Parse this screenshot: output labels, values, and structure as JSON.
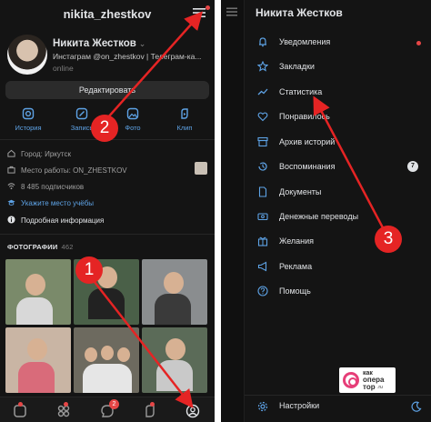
{
  "left": {
    "header_title": "nikita_zhestkov",
    "profile": {
      "name": "Никита Жестков",
      "status": "Инстаграм @on_zhestkov | Телеграм-ка...",
      "online": "online"
    },
    "edit_button": "Редактировать",
    "actions": [
      "История",
      "Запись",
      "Фото",
      "Клип"
    ],
    "info": {
      "city": "Город: Иркутск",
      "work": "Место работы: ON_ZHESTKOV",
      "followers": "8 485 подписчиков",
      "study": "Укажите место учёбы",
      "details": "Подробная информация"
    },
    "photos_title": "ФОТОГРАФИИ",
    "photos_count": "462",
    "tabbar_badge": "2"
  },
  "right": {
    "title": "Никита Жестков",
    "items": [
      {
        "label": "Уведомления",
        "icon": "bell-icon"
      },
      {
        "label": "Закладки",
        "icon": "star-icon"
      },
      {
        "label": "Статистика",
        "icon": "stats-icon"
      },
      {
        "label": "Понравилось",
        "icon": "heart-icon"
      },
      {
        "label": "Архив историй",
        "icon": "archive-icon"
      },
      {
        "label": "Воспоминания",
        "icon": "history-icon",
        "badge": "7"
      },
      {
        "label": "Документы",
        "icon": "document-icon"
      },
      {
        "label": "Денежные переводы",
        "icon": "money-icon"
      },
      {
        "label": "Желания",
        "icon": "wishlist-icon"
      },
      {
        "label": "Реклама",
        "icon": "megaphone-icon"
      },
      {
        "label": "Помощь",
        "icon": "help-icon"
      }
    ],
    "settings": "Настройки"
  },
  "watermark": {
    "line1": "как",
    "line2": "опера",
    "line3": "тор",
    "tld": ".ru"
  },
  "annotations": [
    "1",
    "2",
    "3"
  ],
  "colors": {
    "accent": "#5ea3e6",
    "annotation": "#e52424",
    "background": "#141414"
  }
}
